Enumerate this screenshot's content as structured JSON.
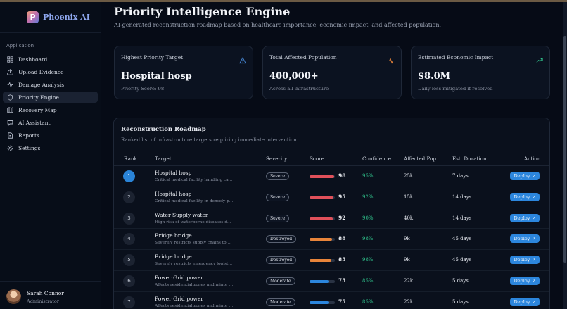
{
  "brand": {
    "logo_letter": "P",
    "name": "Phoenix AI"
  },
  "sidebar": {
    "section": "Application",
    "items": [
      {
        "label": "Dashboard",
        "icon": "grid-icon"
      },
      {
        "label": "Upload Evidence",
        "icon": "upload-icon"
      },
      {
        "label": "Damage Analysis",
        "icon": "activity-icon"
      },
      {
        "label": "Priority Engine",
        "icon": "shield-icon",
        "active": true
      },
      {
        "label": "Recovery Map",
        "icon": "map-icon"
      },
      {
        "label": "AI Assistant",
        "icon": "chat-icon"
      },
      {
        "label": "Reports",
        "icon": "file-icon"
      },
      {
        "label": "Settings",
        "icon": "gear-icon"
      }
    ]
  },
  "user": {
    "name": "Sarah Connor",
    "role": "Administrator"
  },
  "page": {
    "title": "Priority Intelligence Engine",
    "subtitle": "AI-generated reconstruction roadmap based on healthcare importance, economic impact, and affected population."
  },
  "cards": [
    {
      "title": "Highest Priority Target",
      "value": "Hospital hosp",
      "note": "Priority Score: 98",
      "icon": "alert-triangle-icon",
      "icon_color": "#4a8fe0"
    },
    {
      "title": "Total Affected Population",
      "value": "400,000+",
      "note": "Across all infrastructure",
      "icon": "pulse-icon",
      "icon_color": "#e8843a"
    },
    {
      "title": "Estimated Economic Impact",
      "value": "$8.0M",
      "note": "Daily loss mitigated if resolved",
      "icon": "trending-up-icon",
      "icon_color": "#2fbf8a"
    }
  ],
  "roadmap": {
    "title": "Reconstruction Roadmap",
    "subtitle": "Ranked list of infrastructure targets requiring immediate intervention.",
    "columns": [
      "Rank",
      "Target",
      "Severity",
      "Score",
      "Confidence",
      "Affected Pop.",
      "Est. Duration",
      "Action"
    ],
    "rows": [
      {
        "rank": "1",
        "name": "Hospital hosp",
        "desc": "Critical medical facility handling casu...",
        "severity": "Severe",
        "score": 98,
        "confidence": "95%",
        "pop": "25k",
        "duration": "7 days",
        "action": "Deploy"
      },
      {
        "rank": "2",
        "name": "Hospital hosp",
        "desc": "Critical medical facility in densely pop...",
        "severity": "Severe",
        "score": 95,
        "confidence": "92%",
        "pop": "15k",
        "duration": "14 days",
        "action": "Deploy"
      },
      {
        "rank": "3",
        "name": "Water Supply water",
        "desc": "High risk of waterborne diseases due t...",
        "severity": "Severe",
        "score": 92,
        "confidence": "90%",
        "pop": "40k",
        "duration": "14 days",
        "action": "Deploy"
      },
      {
        "rank": "4",
        "name": "Bridge bridge",
        "desc": "Severely restricts supply chains to nort...",
        "severity": "Destroyed",
        "score": 88,
        "confidence": "98%",
        "pop": "9k",
        "duration": "45 days",
        "action": "Deploy"
      },
      {
        "rank": "5",
        "name": "Bridge bridge",
        "desc": "Severely restricts emergency logistics ...",
        "severity": "Destroyed",
        "score": 85,
        "confidence": "98%",
        "pop": "9k",
        "duration": "45 days",
        "action": "Deploy"
      },
      {
        "rank": "6",
        "name": "Power Grid power",
        "desc": "Affects residential zones and minor co...",
        "severity": "Moderate",
        "score": 75,
        "confidence": "85%",
        "pop": "22k",
        "duration": "5 days",
        "action": "Deploy"
      },
      {
        "rank": "7",
        "name": "Power Grid power",
        "desc": "Affects residential zones and minor co...",
        "severity": "Moderate",
        "score": 75,
        "confidence": "85%",
        "pop": "22k",
        "duration": "5 days",
        "action": "Deploy"
      }
    ]
  },
  "colors": {
    "severe_bar": "#e0505a",
    "destroyed_bar": "#e8843a",
    "moderate_bar": "#2c86dd",
    "confidence": "#2fbf8a",
    "accent": "#2c86dd"
  }
}
